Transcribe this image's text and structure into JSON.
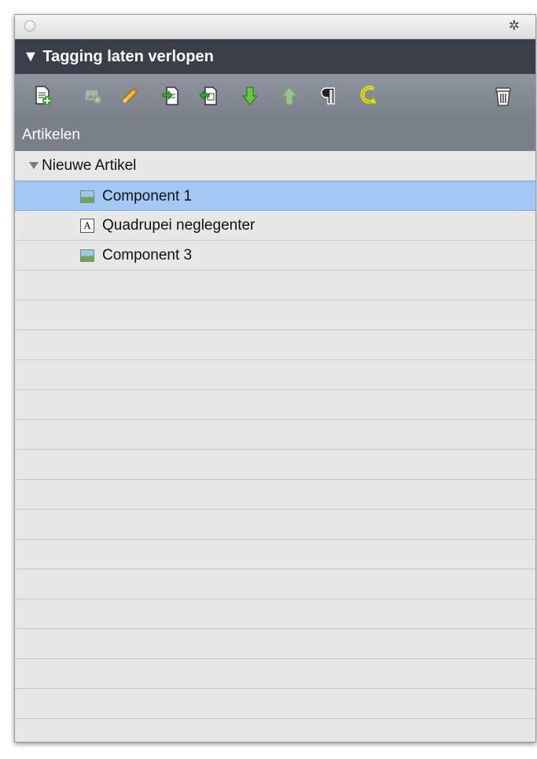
{
  "panel": {
    "section_title": "Tagging laten verlopen",
    "section_arrow": "▼",
    "articles_label": "Artikelen"
  },
  "toolbar": {
    "icons": [
      "new-article-icon",
      "add-image-icon",
      "edit-pencil-icon",
      "export-icon",
      "import-icon",
      "move-down-icon",
      "move-up-icon",
      "paragraph-icon",
      "refresh-icon",
      "trash-icon"
    ]
  },
  "tree": {
    "group": {
      "label": "Nieuwe Artikel",
      "expanded": true
    },
    "items": [
      {
        "label": "Component 1",
        "type": "image",
        "selected": true
      },
      {
        "label": "Quadrupei neglegenter",
        "type": "text",
        "selected": false
      },
      {
        "label": "Component 3",
        "type": "image",
        "selected": false
      }
    ]
  },
  "colors": {
    "header_bg": "#3a3f4a",
    "toolbar_bg": "#7a8089",
    "selection": "#a4c8f5",
    "list_bg": "#e7e7e7"
  }
}
